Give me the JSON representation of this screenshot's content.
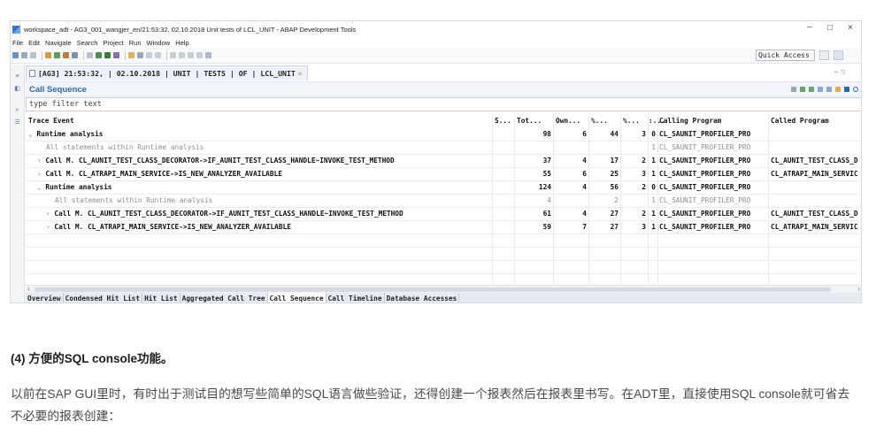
{
  "window": {
    "title": "workspace_adt - AG3_001_wangjer_en/21:53:32, 02.10.2018 Unit tests of LCL_UNIT - ABAP Development Tools",
    "controls": [
      "−",
      "□",
      "×"
    ]
  },
  "menu": [
    "File",
    "Edit",
    "Navigate",
    "Search",
    "Project",
    "Run",
    "Window",
    "Help"
  ],
  "toolbar": {
    "quick_access": "Quick Access",
    "icons": [
      "new-icon",
      "save-icon",
      "print-icon",
      "run-icon",
      "debug-icon",
      "search-icon",
      "back-icon",
      "forward-icon"
    ]
  },
  "editor_tab": {
    "label": "[AG3] 21:53:32, | 02.10.2018 | UNIT | TESTS | OF | LCL_UNIT",
    "close": "☒",
    "minmax": "⎯ ▢"
  },
  "view": {
    "title": "Call Sequence",
    "filter_placeholder": "type filter text"
  },
  "table": {
    "columns": [
      "Trace Event",
      "S...",
      "Tot...",
      "Own...",
      "%...",
      "%...",
      ":...",
      "Calling Program",
      "Called Program"
    ],
    "rows": [
      {
        "indent": 0,
        "twisty": "⌄",
        "event": "Runtime analysis",
        "tot": "98",
        "own": "6",
        "p1": "44",
        "p2": "3",
        "c": "0",
        "calling": "CL_SAUNIT_PROFILER_PRO",
        "called": "",
        "muted": false,
        "bold": true
      },
      {
        "indent": 2,
        "twisty": "",
        "event": "All statements within Runtime analysis",
        "tot": "",
        "own": "",
        "p1": "",
        "p2": "",
        "c": "1",
        "calling": "CL_SAUNIT_PROFILER_PRO",
        "called": "",
        "muted": true,
        "bold": false
      },
      {
        "indent": 1,
        "twisty": "›",
        "event": "Call M.  CL_AUNIT_TEST_CLASS_DECORATOR->IF_AUNIT_TEST_CLASS_HANDLE~INVOKE_TEST_METHOD",
        "tot": "37",
        "own": "4",
        "p1": "17",
        "p2": "2",
        "c": "1",
        "calling": "CL_SAUNIT_PROFILER_PRO",
        "called": "CL_AUNIT_TEST_CLASS_D",
        "muted": false,
        "bold": true
      },
      {
        "indent": 1,
        "twisty": "›",
        "event": "Call M.  CL_ATRAPI_MAIN_SERVICE->IS_NEW_ANALYZER_AVAILABLE",
        "tot": "55",
        "own": "6",
        "p1": "25",
        "p2": "3",
        "c": "1",
        "calling": "CL_SAUNIT_PROFILER_PRO",
        "called": "CL_ATRAPI_MAIN_SERVIC",
        "muted": false,
        "bold": true
      },
      {
        "indent": 1,
        "twisty": "⌄",
        "event": "Runtime analysis",
        "tot": "124",
        "own": "4",
        "p1": "56",
        "p2": "2",
        "c": "0",
        "calling": "CL_SAUNIT_PROFILER_PRO",
        "called": "",
        "muted": false,
        "bold": true
      },
      {
        "indent": 3,
        "twisty": "",
        "event": "All statements within Runtime analysis",
        "tot": "4",
        "own": "",
        "p1": "2",
        "p2": "",
        "c": "1",
        "calling": "CL_SAUNIT_PROFILER_PRO",
        "called": "",
        "muted": true,
        "bold": false
      },
      {
        "indent": 2,
        "twisty": "›",
        "event": "Call M.  CL_AUNIT_TEST_CLASS_DECORATOR->IF_AUNIT_TEST_CLASS_HANDLE~INVOKE_TEST_METHOD",
        "tot": "61",
        "own": "4",
        "p1": "27",
        "p2": "2",
        "c": "1",
        "calling": "CL_SAUNIT_PROFILER_PRO",
        "called": "CL_AUNIT_TEST_CLASS_D",
        "muted": false,
        "bold": true
      },
      {
        "indent": 2,
        "twisty": "›",
        "event": "Call M.  CL_ATRAPI_MAIN_SERVICE->IS_NEW_ANALYZER_AVAILABLE",
        "tot": "59",
        "own": "7",
        "p1": "27",
        "p2": "3",
        "c": "1",
        "calling": "CL_SAUNIT_PROFILER_PRO",
        "called": "CL_ATRAPI_MAIN_SERVIC",
        "muted": false,
        "bold": true
      }
    ]
  },
  "bottom_tabs": [
    "Overview",
    "Condensed Hit List",
    "Hit List",
    "Aggregated Call Tree",
    "Call Sequence",
    "Call Timeline",
    "Database Accesses"
  ],
  "active_bottom_tab": "Call Sequence",
  "article": {
    "heading": "(4) 方便的SQL console功能。",
    "paragraph": "以前在SAP GUI里时，有时出于测试目的想写些简单的SQL语言做些验证，还得创建一个报表然后在报表里书写。在ADT里，直接使用SQL console就可省去不必要的报表创建："
  },
  "colors": {
    "accent": "#2e66b3",
    "view_header_bg": "#f1f5fa",
    "bottom_tab_bg": "#e6ebf2",
    "muted_text": "#8a8f96"
  }
}
